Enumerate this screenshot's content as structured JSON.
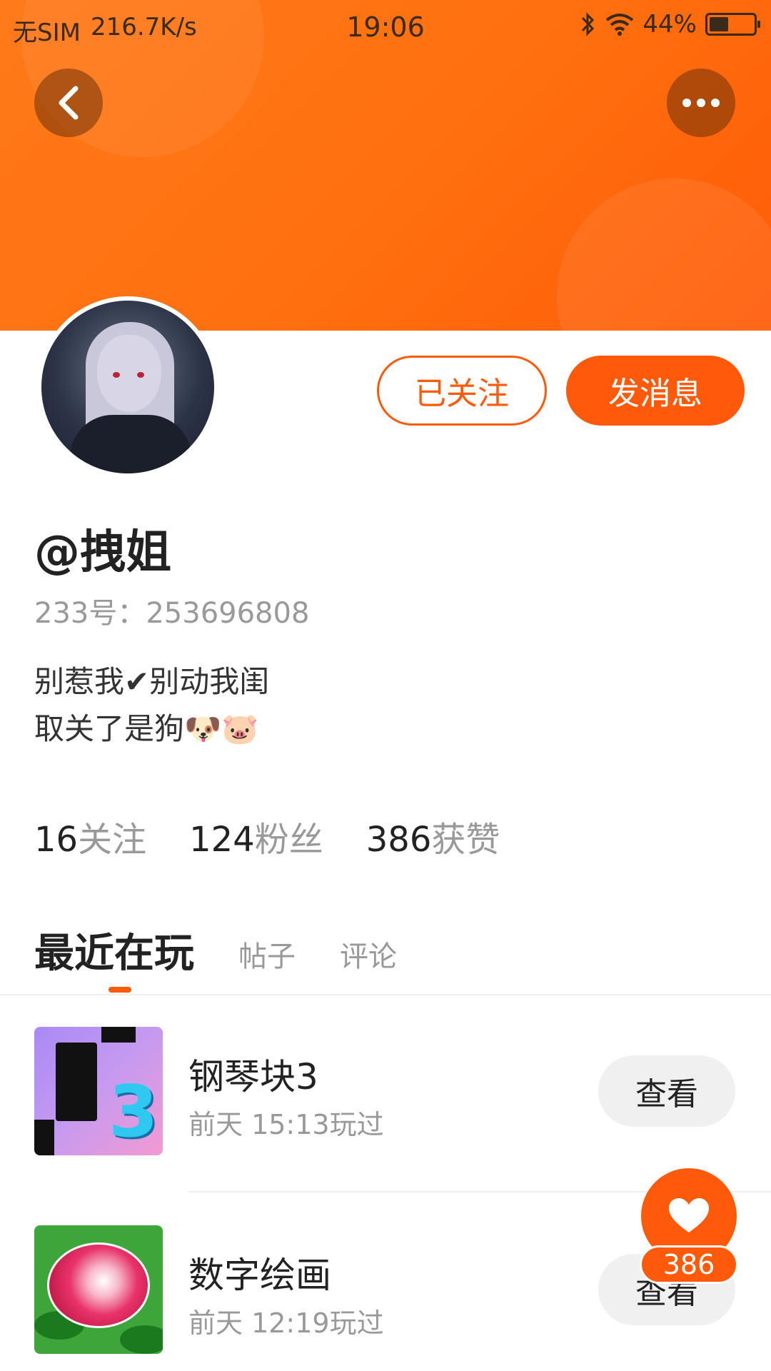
{
  "status_bar": {
    "carrier": "无SIM",
    "speed": "216.7K/s",
    "time": "19:06",
    "battery": "44%"
  },
  "header": {
    "back_icon": "chevron-left-icon",
    "more_icon": "more-dots-icon"
  },
  "profile": {
    "follow_button": "已关注",
    "message_button": "发消息",
    "username": "@拽姐",
    "user_id": "233号：253696808",
    "bio_line1": "别惹我✔别动我闺",
    "bio_line2": "取关了是狗🐶🐷"
  },
  "stats": [
    {
      "value": "16",
      "label": "关注"
    },
    {
      "value": "124",
      "label": "粉丝"
    },
    {
      "value": "386",
      "label": "获赞"
    }
  ],
  "tabs": [
    {
      "label": "最近在玩",
      "active": true
    },
    {
      "label": "帖子",
      "active": false
    },
    {
      "label": "评论",
      "active": false
    }
  ],
  "games": [
    {
      "title": "钢琴块3",
      "played": "前天 15:13玩过",
      "action": "查看",
      "icon": "piano-tiles-icon",
      "icon_text": "3"
    },
    {
      "title": "数字绘画",
      "played": "前天 12:19玩过",
      "action": "查看",
      "icon": "rose-painting-icon"
    }
  ],
  "like_fab": {
    "icon": "heart-icon",
    "count": "386"
  },
  "colors": {
    "accent": "#ff5a0a",
    "header_gradient_start": "#ff7a1a",
    "header_gradient_end": "#ff5c08"
  }
}
